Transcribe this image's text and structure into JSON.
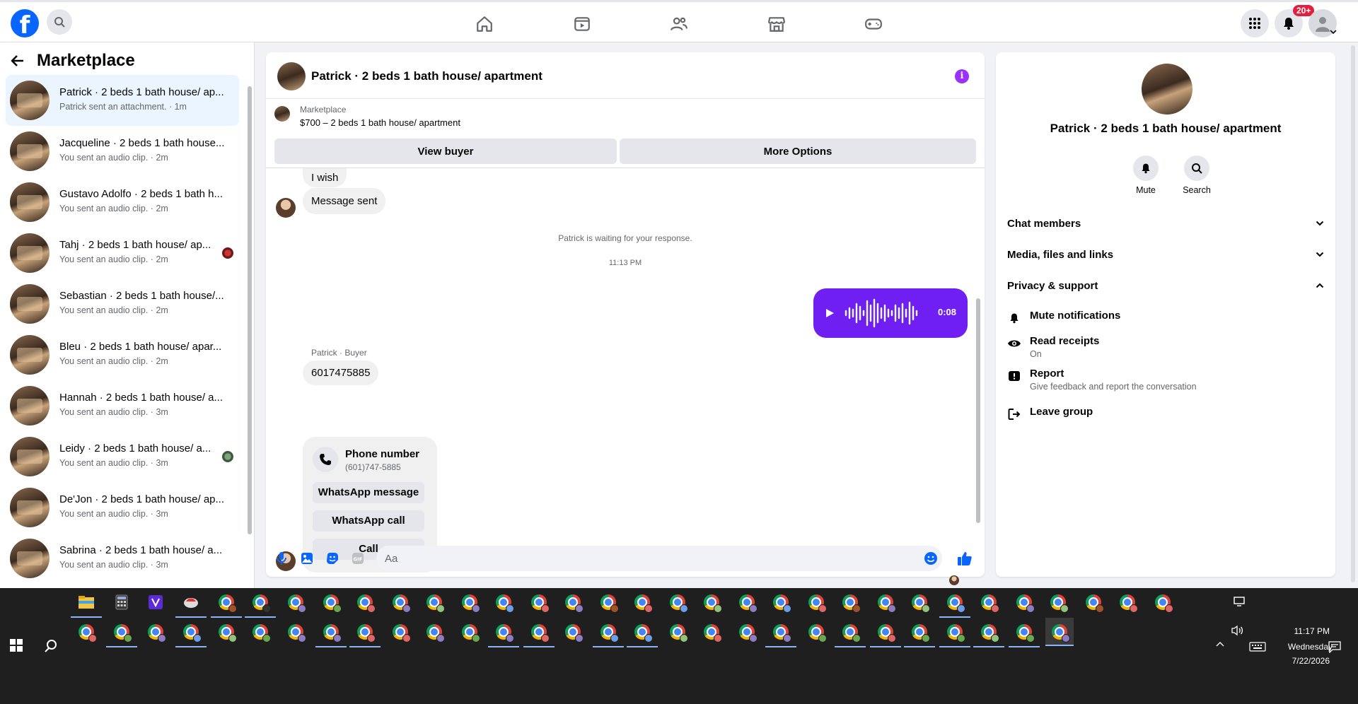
{
  "topnav": {
    "logo": "f",
    "notifications_badge": "20+",
    "tabs": [
      "home-icon",
      "video-icon",
      "friends-icon",
      "marketplace-icon",
      "gaming-icon"
    ]
  },
  "left": {
    "title": "Marketplace",
    "conversations": [
      {
        "name": "Patrick · 2 beds 1 bath house/ ap...",
        "sub": "Patrick sent an attachment. · 1m"
      },
      {
        "name": "Jacqueline · 2 beds 1 bath house...",
        "sub": "You sent an audio clip. · 2m"
      },
      {
        "name": "Gustavo Adolfo · 2 beds 1 bath h...",
        "sub": "You sent an audio clip. · 2m"
      },
      {
        "name": "Tahj · 2 beds 1 bath house/ ap...",
        "sub": "You sent an audio clip. · 2m"
      },
      {
        "name": "Sebastian · 2 beds 1 bath house/...",
        "sub": "You sent an audio clip. · 2m"
      },
      {
        "name": "Bleu · 2 beds 1 bath house/ apar...",
        "sub": "You sent an audio clip. · 2m"
      },
      {
        "name": "Hannah · 2 beds 1 bath house/ a...",
        "sub": "You sent an audio clip. · 3m"
      },
      {
        "name": "Leidy · 2 beds 1 bath house/ a...",
        "sub": "You sent an audio clip. · 3m"
      },
      {
        "name": "De'Jon · 2 beds 1 bath house/ ap...",
        "sub": "You sent an audio clip. · 3m"
      },
      {
        "name": "Sabrina · 2 beds 1 bath house/ a...",
        "sub": "You sent an audio clip. · 3m"
      }
    ]
  },
  "chat": {
    "title": "Patrick · 2 beds 1 bath house/ apartment",
    "marketplace_label": "Marketplace",
    "listing": "$700 – 2 beds 1 bath house/ apartment",
    "view_buyer": "View buyer",
    "more_options": "More Options",
    "msg_wish": "I wish",
    "msg_sent": "Message sent",
    "waiting_note": "Patrick is waiting for your response.",
    "time": "11:13 PM",
    "voice_duration": "0:08",
    "sender_label": "Patrick · Buyer",
    "phone_msg": "6017475885",
    "phone_card": {
      "title": "Phone number",
      "number": "(601)747-5885",
      "whatsapp_message": "WhatsApp message",
      "whatsapp_call": "WhatsApp call",
      "call": "Call"
    },
    "composer_placeholder": "Aa"
  },
  "right": {
    "name": "Patrick · 2 beds 1 bath house/ apartment",
    "mute": "Mute",
    "search": "Search",
    "sections": {
      "chat_members": "Chat members",
      "media": "Media, files and links",
      "privacy": "Privacy & support"
    },
    "items": {
      "mute_notifications": "Mute notifications",
      "read_receipts": "Read receipts",
      "read_receipts_sub": "On",
      "report": "Report",
      "report_sub": "Give feedback and report the conversation",
      "leave_group": "Leave group"
    }
  },
  "taskbar": {
    "time": "11:17 PM",
    "day": "Wednesday",
    "date": "7/22/2026"
  },
  "colors": {
    "brand": "#0866ff",
    "voice_bubble": "#6f1ff1",
    "badge": "#e41e3f"
  }
}
